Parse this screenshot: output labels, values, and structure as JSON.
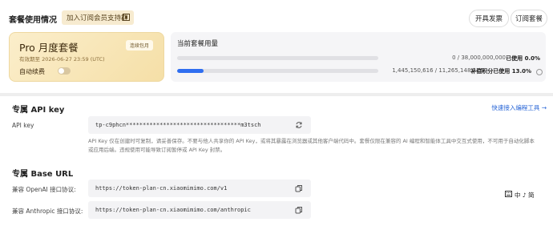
{
  "header": {
    "title": "套餐使用情况",
    "support_label": "加入订阅会员支持群",
    "invoice_label": "开具发票",
    "orders_label": "订阅套餐"
  },
  "plan": {
    "name": "Pro 月度套餐",
    "expiry": "有效期至 2026-06-27 23:59 (UTC)",
    "tag": "连续包月",
    "auto_renew_label": "自动续费",
    "auto_renew_on": false
  },
  "usage": {
    "title": "当前套餐用量",
    "row1": {
      "nums": "0 / 38,000,000,000",
      "label": "已使用",
      "pct": "0.0%",
      "fill": 0.0
    },
    "row2": {
      "nums": "1,445,150,616 / 11,265,148,226",
      "label": "补偿积分已使用",
      "pct": "13.0%",
      "fill": 0.13
    }
  },
  "api": {
    "title": "专属 API key",
    "link": "快速接入编程工具 →",
    "label": "API key",
    "value": "tp-c9phcn**********************************m3tsch",
    "note": "API Key 仅在创建时可复制，请妥善保存。不要与他人共享你的 API Key，或将其暴露在浏览器或其他客户端代码中。套餐仅限在兼容的 AI 编程和智能体工具中交互式使用，不可用于自动化脚本或应用后端。违规使用可能导致订阅暂停或 API Key 封禁。"
  },
  "base": {
    "title": "专属 Base URL",
    "openai_label": "兼容 OpenAI 接口协议:",
    "openai_url": "https://token-plan-cn.xiaomimimo.com/v1",
    "anthropic_label": "兼容 Anthropic 接口协议:",
    "anthropic_url": "https://token-plan-cn.xiaomimimo.com/anthropic"
  },
  "side_tool": "中 ♪ 简"
}
